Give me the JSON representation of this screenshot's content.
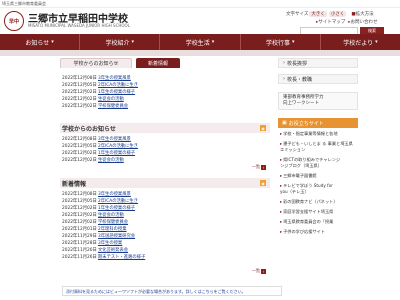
{
  "topbar": {
    "org": "埼玉県三郷市教育委員会"
  },
  "header": {
    "school_name": "三郷市立早稲田中学校",
    "school_en": "MISATO MUNICIPAL WASEDA JUNIOR HIGH SCHOOL",
    "logo_text": "早中"
  },
  "util": {
    "font_size_label": "文字サイズ",
    "font_large": "大きく",
    "font_small": "小さく",
    "language_label": "拡大方法",
    "sitemap": "サイトマップ",
    "contact": "お問い合わせ",
    "search_placeholder": "",
    "search_button": "検索"
  },
  "nav": {
    "items": [
      {
        "label": "お知らせ"
      },
      {
        "label": "学校紹介"
      },
      {
        "label": "学校生活"
      },
      {
        "label": "学校行事"
      },
      {
        "label": "学校だより"
      }
    ]
  },
  "tabs": {
    "active": "学校からのお知らせ",
    "inactive": "新着情報"
  },
  "section1": {
    "rows": [
      {
        "date": "2022年12月08日",
        "title": "3年生の授業風景"
      },
      {
        "date": "2022年12月05日",
        "title": "2年ICAの活動に生き"
      },
      {
        "date": "2022年12月02日",
        "title": "1年生の授業の様子"
      },
      {
        "date": "2022年12月02日",
        "title": "生徒会の活動"
      },
      {
        "date": "2022年12月02日",
        "title": "学校保健委員会"
      }
    ]
  },
  "section2": {
    "title": "学校からのお知らせ",
    "rows": [
      {
        "date": "2022年12月08日",
        "title": "3年生の授業風景"
      },
      {
        "date": "2022年12月05日",
        "title": "2年ICAの活動に生き"
      },
      {
        "date": "2022年12月02日",
        "title": "1年生の授業の様子"
      },
      {
        "date": "2022年12月02日",
        "title": "生徒会の活動"
      }
    ],
    "more": "一覧"
  },
  "section3": {
    "title": "新着情報",
    "rows": [
      {
        "date": "2022年12月08日",
        "title": "3年生の授業風景"
      },
      {
        "date": "2022年12月05日",
        "title": "2年ICAの活動に生き"
      },
      {
        "date": "2022年12月02日",
        "title": "1年生の授業の様子"
      },
      {
        "date": "2022年12月02日",
        "title": "生徒会の活動"
      },
      {
        "date": "2022年12月02日",
        "title": "学校保健委員会"
      },
      {
        "date": "2022年12月01日",
        "title": "2年理科の授業"
      },
      {
        "date": "2022年11月29日",
        "title": "3年国語授業研究会"
      },
      {
        "date": "2022年11月28日",
        "title": "3年生の授業"
      },
      {
        "date": "2022年11月26日",
        "title": "文化芸術発表会"
      },
      {
        "date": "2022年11月26日",
        "title": "期末テスト・進路の様子"
      }
    ],
    "more": "一覧"
  },
  "notice": "添付資料を見るためにはビューワソフトが必要な場合があります。詳しくはこちらをご覧ください。",
  "side": {
    "box1": "校長挨拶",
    "box2": "校長・教職",
    "multi": [
      "東部教育事務所学力",
      "向上ワークシート"
    ],
    "head": "お役立ちサイト",
    "links": [
      "学校・指定事業等情報と各地",
      "運子ども・いしとま る 事業と埼玉県",
      "エミッション",
      "県ICTの取り組みでチャレンジ",
      "ンジブログ（埼玉県）",
      "三郷市電子図書館",
      "テレビで学ぼう Study for",
      "you（テレ玉）",
      "彩の国教育ナビ（パネット）",
      "家庭学習支援サイト埼玉県",
      "埼玉県教育委員会の「授業",
      "子供の学び応援サイト"
    ]
  },
  "colors": {
    "brand": "#7a1d1d",
    "accent": "#e79332",
    "link": "#1a3d8f"
  }
}
